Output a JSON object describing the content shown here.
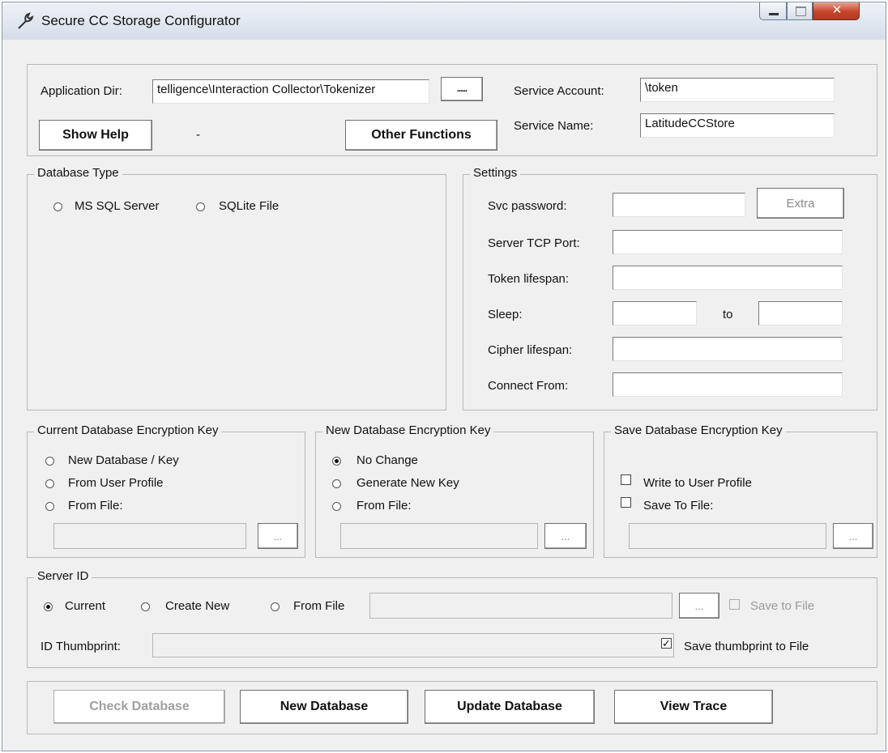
{
  "window": {
    "title": "Secure CC Storage Configurator",
    "icon": "wrench-icon",
    "controls": [
      "minimize-icon",
      "maximize-icon",
      "close-icon"
    ]
  },
  "top": {
    "app_dir_label": "Application Dir:",
    "app_dir_value": "telligence\\Interaction Collector\\Tokenizer",
    "browse_label": "......",
    "show_help_label": "Show Help",
    "status_text": "-",
    "other_functions_label": "Other Functions",
    "service_account_label": "Service Account:",
    "service_account_value": "\\token",
    "service_name_label": "Service Name:",
    "service_name_value": "LatitudeCCStore"
  },
  "database_type": {
    "legend": "Database Type",
    "options": [
      "MS SQL Server",
      "SQLite File"
    ],
    "selected": null
  },
  "settings": {
    "legend": "Settings",
    "svc_password_label": "Svc password:",
    "extra_label": "Extra",
    "server_tcp_port_label": "Server TCP Port:",
    "token_lifespan_label": "Token lifespan:",
    "sleep_label": "Sleep:",
    "to_label": "to",
    "cipher_lifespan_label": "Cipher lifespan:",
    "connect_from_label": "Connect From:"
  },
  "current_key": {
    "legend": "Current Database Encryption Key",
    "options": [
      "New Database / Key",
      "From User Profile",
      "From File:"
    ],
    "browse_label": "..."
  },
  "new_key": {
    "legend": "New Database Encryption Key",
    "options": [
      "No Change",
      "Generate New Key",
      "From File:"
    ],
    "selected": "No Change",
    "browse_label": "..."
  },
  "save_key": {
    "legend": "Save Database Encryption Key",
    "write_to_profile_label": "Write to User Profile",
    "save_to_file_label": "Save To File:",
    "browse_label": "..."
  },
  "server_id": {
    "legend": "Server ID",
    "options": [
      "Current",
      "Create New",
      "From File"
    ],
    "selected": "Current",
    "browse_label": "...",
    "save_to_file_label": "Save to File",
    "thumbprint_label": "ID Thumbprint:",
    "save_thumbprint_label": "Save thumbprint to File",
    "save_thumbprint_checked": true
  },
  "actions": {
    "check_database_label": "Check Database",
    "new_database_label": "New Database",
    "update_database_label": "Update Database",
    "view_trace_label": "View Trace"
  }
}
